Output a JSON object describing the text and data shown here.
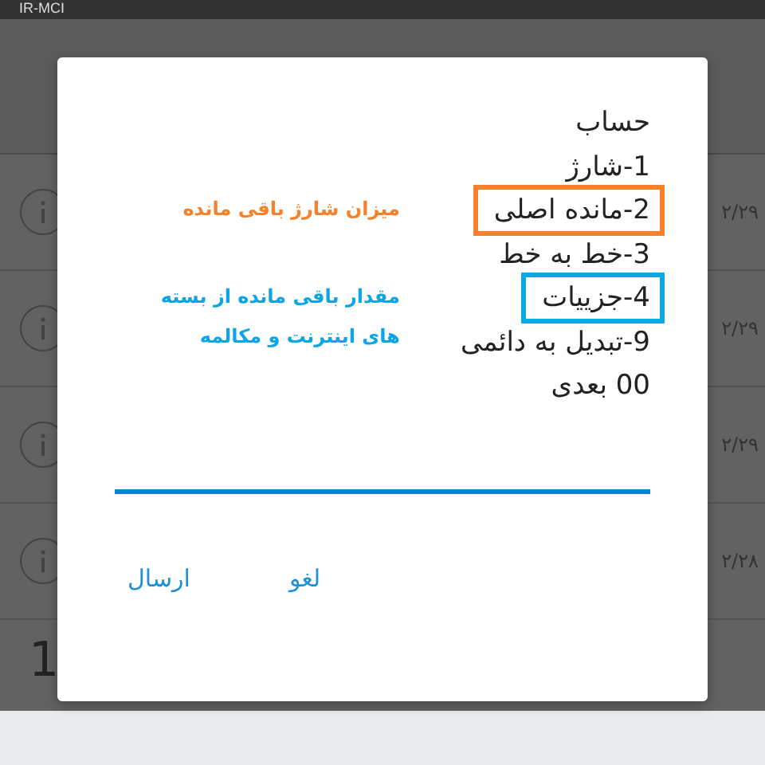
{
  "status_bar": {
    "carrier": "IR-MCI"
  },
  "list_rows": [
    {
      "date": "۲/۲۹"
    },
    {
      "date": "۲/۲۹"
    },
    {
      "date": "۲/۲۹"
    },
    {
      "date": "۲/۲۸"
    }
  ],
  "keypad": {
    "key": "1"
  },
  "dialog": {
    "menu": [
      {
        "text": "حساب"
      },
      {
        "text": "1-شارژ"
      },
      {
        "text": "2-مانده اصلی",
        "color": "#f5822a",
        "note": "میزان شارژ باقی مانده"
      },
      {
        "text": "3-خط به خط"
      },
      {
        "text": "4-جزییات",
        "color": "#0ea5e6",
        "note": "مقدار باقی مانده از بسته های اینترنت و مکالمه"
      },
      {
        "text": "9-تبدیل به دائمی"
      },
      {
        "text": "00 بعدی"
      }
    ],
    "input": {
      "focused": true
    },
    "buttons": [
      "لغو",
      "ارسال"
    ]
  }
}
